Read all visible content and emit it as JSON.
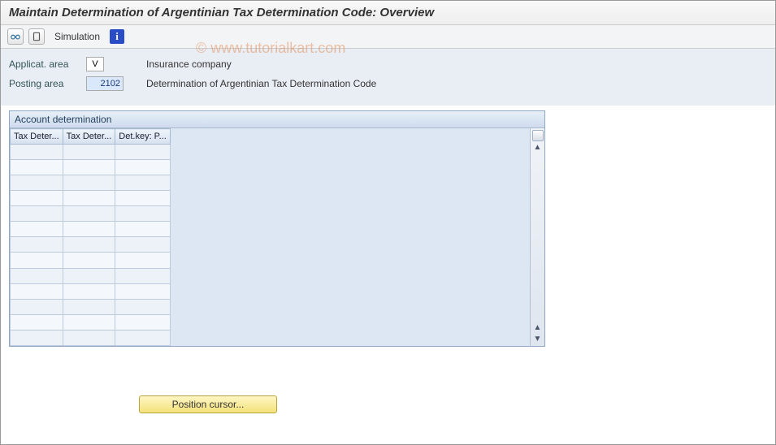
{
  "title": "Maintain Determination of Argentinian Tax Determination Code: Overview",
  "watermark": "© www.tutorialkart.com",
  "toolbar": {
    "simulation_label": "Simulation",
    "info_glyph": "i"
  },
  "form": {
    "applicat_label": "Applicat. area",
    "applicat_value": "V",
    "applicat_desc": "Insurance company",
    "posting_label": "Posting area",
    "posting_value": "2102",
    "posting_desc": "Determination of Argentinian Tax Determination Code"
  },
  "panel": {
    "title": "Account determination",
    "columns": [
      "Tax Deter...",
      "Tax Deter...",
      "Det.key: P..."
    ],
    "row_count": 13
  },
  "buttons": {
    "position_cursor": "Position cursor..."
  }
}
